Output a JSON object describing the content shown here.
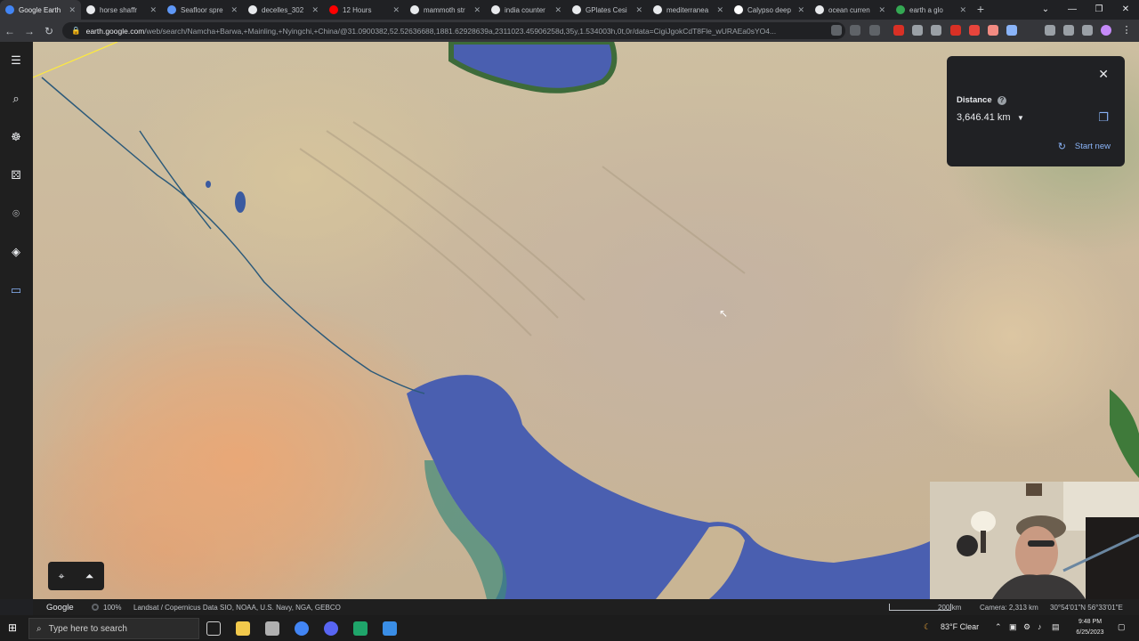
{
  "browser": {
    "tabs": [
      {
        "label": "Google Earth",
        "active": true,
        "favicon_color": "#4285f4"
      },
      {
        "label": "horse shaffr",
        "active": false,
        "favicon_color": "#e8eaed"
      },
      {
        "label": "Seafloor spre",
        "active": false,
        "favicon_color": "#5e97f6"
      },
      {
        "label": "decelles_302",
        "active": false,
        "favicon_color": "#e8eaed"
      },
      {
        "label": "12 Hours",
        "active": false,
        "favicon_color": "#ff0000"
      },
      {
        "label": "mammoth str",
        "active": false,
        "favicon_color": "#e8eaed"
      },
      {
        "label": "india counter",
        "active": false,
        "favicon_color": "#e8eaed"
      },
      {
        "label": "GPlates Cesi",
        "active": false,
        "favicon_color": "#e8eaed"
      },
      {
        "label": "mediterranea",
        "active": false,
        "favicon_color": "#e8eaed"
      },
      {
        "label": "Calypso deep",
        "active": false,
        "favicon_color": "#ffffff"
      },
      {
        "label": "ocean curren",
        "active": false,
        "favicon_color": "#e8eaed"
      },
      {
        "label": "earth a glo",
        "active": false,
        "favicon_color": "#34a853"
      }
    ],
    "url_domain": "earth.google.com",
    "url_path": "/web/search/Namcha+Barwa,+Mainling,+Nyingchi,+China/@31.0900382,52.52636688,1881.62928639a,2311023.45906258d,35y,1.534003h,0t,0r/data=CigiJgokCdT8Fle_wURAEa0sYO4..."
  },
  "sidebar": {
    "menu_icon": "menu-icon",
    "items": [
      "search-icon",
      "voyager-icon",
      "feeling-lucky-icon",
      "projects-icon",
      "map-style-icon",
      "measure-icon"
    ]
  },
  "measure_panel": {
    "label": "Distance",
    "value": "3,646.41 km",
    "start_new": "Start new",
    "help": "?"
  },
  "status_bar": {
    "logo": "Google",
    "progress": "100%",
    "attribution": "Landsat / Copernicus  Data SIO, NOAA, U.S. Navy, NGA, GEBCO",
    "scale": "200 km",
    "camera": "Camera: 2,313 km",
    "coordinates": "30°54'01\"N 56°33'01\"E"
  },
  "taskbar": {
    "search_placeholder": "Type here to search",
    "weather": "83°F  Clear",
    "time": "9:48 PM",
    "date": "6/25/2023"
  },
  "colors": {
    "sea": "#4a5fb0",
    "panel_bg": "#202124",
    "link": "#8ab4f8"
  }
}
